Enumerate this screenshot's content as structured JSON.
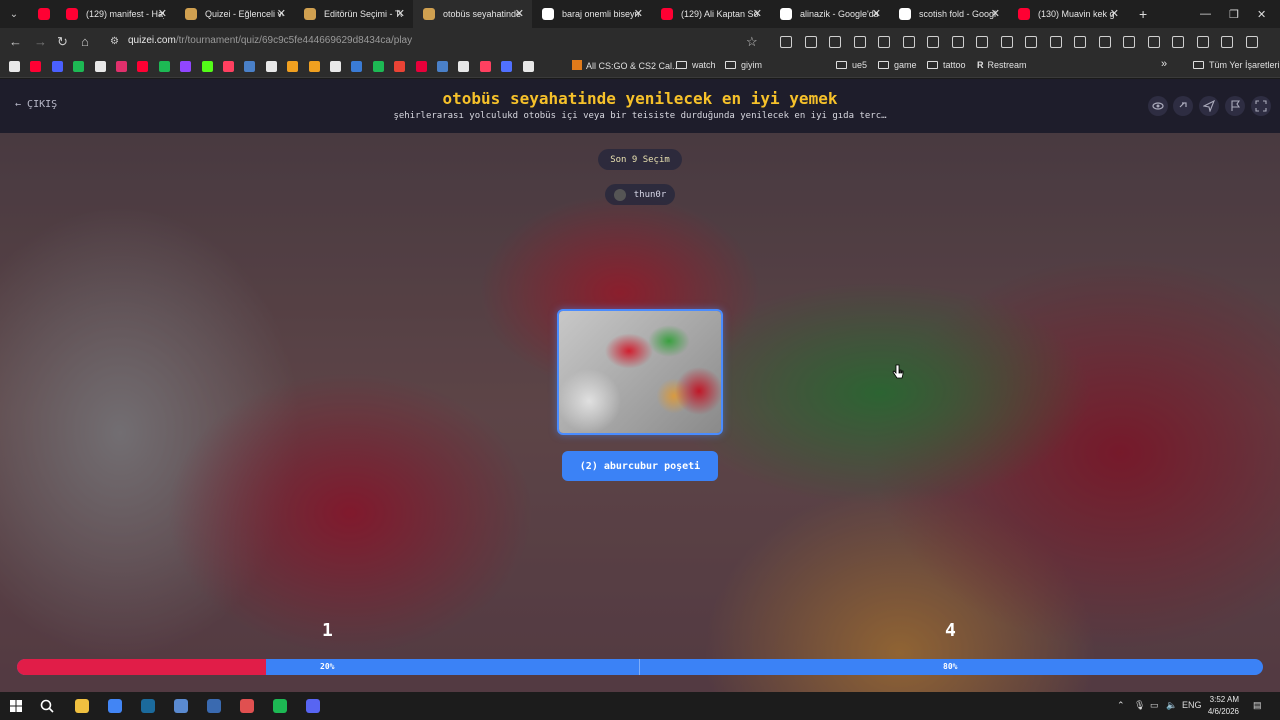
{
  "browser": {
    "tabs": [
      {
        "title": "",
        "favicon": "youtube-icon",
        "color": "#ff0033"
      },
      {
        "title": "(129) manifest - Hay",
        "favicon": "youtube-icon",
        "color": "#ff0033"
      },
      {
        "title": "Quizei - Eğlenceli ve",
        "favicon": "quizei-icon",
        "color": "#d0a050"
      },
      {
        "title": "Editörün Seçimi - Tu",
        "favicon": "quizei-icon",
        "color": "#d0a050"
      },
      {
        "title": "otobüs seyahatinde",
        "favicon": "quizei-icon",
        "color": "#d0a050",
        "active": true
      },
      {
        "title": "baraj onemli biseym",
        "favicon": "google-icon",
        "color": "#ffffff"
      },
      {
        "title": "(129) Ali Kaptan Söz",
        "favicon": "youtube-icon",
        "color": "#ff0033"
      },
      {
        "title": "alinazik - Google'da",
        "favicon": "google-icon",
        "color": "#ffffff"
      },
      {
        "title": "scotish fold - Googl",
        "favicon": "google-icon",
        "color": "#ffffff"
      },
      {
        "title": "(130) Muavin kek g",
        "favicon": "youtube-icon",
        "color": "#ff0033"
      }
    ],
    "url_host": "quizei.com",
    "url_path": "/tr/tournament/quiz/69c9c5fe444669629d8434ca/play",
    "bookmarks": [
      {
        "label": "All CS:GO & CS2 Cal...",
        "type": "link"
      },
      {
        "label": "watch",
        "type": "folder"
      },
      {
        "label": "giyim",
        "type": "folder"
      },
      {
        "label": "ue5",
        "type": "folder"
      },
      {
        "label": "game",
        "type": "folder"
      },
      {
        "label": "tattoo",
        "type": "folder"
      },
      {
        "label": "Restream",
        "type": "link"
      },
      {
        "label": "Tüm Yer İşaretleri",
        "type": "folder"
      }
    ]
  },
  "quiz": {
    "exit_label": "ÇIKIŞ",
    "title": "otobüs seyahatinde yenilecek en iyi yemek",
    "subtitle": "şehirlerarası yolculukd otobüs içi veya bir teisiste durduğunda yenilecek en iyi gıda terc…",
    "round_label": "Son 9 Seçim",
    "username": "thun0r",
    "choice_label": "(2) aburcubur poşeti",
    "score_left": "1",
    "score_right": "4",
    "pct_left_label": "20%",
    "pct_right_label": "80%",
    "pct_left_value": 0.2,
    "pct_right_value": 0.8,
    "colors": {
      "accent": "#3b82f6",
      "title": "#f6c12a",
      "left_bar": "#e11d48",
      "right_bar": "#3b82f6"
    }
  },
  "taskbar": {
    "lang": "ENG",
    "time": "3:52 AM",
    "date": "4/6/2026"
  }
}
